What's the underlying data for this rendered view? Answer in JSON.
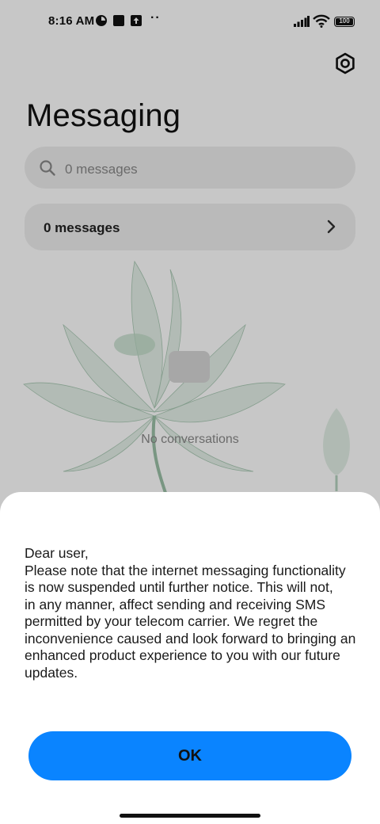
{
  "status_bar": {
    "time": "8:16 AM",
    "icons": [
      "app-notification-icon",
      "square-notification-icon",
      "upload-notification-icon",
      "more-dots-icon",
      "signal-icon",
      "wifi-icon",
      "battery-icon"
    ],
    "more": "··",
    "battery": "100"
  },
  "header": {
    "title": "Messaging",
    "settings_icon": "settings-icon"
  },
  "search": {
    "placeholder": "0 messages",
    "icon": "search-icon"
  },
  "messages_card": {
    "label": "0 messages",
    "icon": "chevron-right-icon"
  },
  "empty_state": {
    "text": "No conversations",
    "icon": "empty-inbox-icon"
  },
  "dialog": {
    "lines": [
      "Dear user,",
      "Please note that the internet messaging functionality",
      "is now suspended until further notice. This will not,",
      "in any manner, affect sending and receiving SMS",
      "permitted by your telecom carrier. We regret the",
      "inconvenience caused and look forward to bringing an",
      "enhanced product experience to you with our future",
      "updates."
    ],
    "ok_label": "OK"
  },
  "colors": {
    "accent": "#0a84ff",
    "sheet": "#ffffff",
    "card": "#eeeeee"
  }
}
